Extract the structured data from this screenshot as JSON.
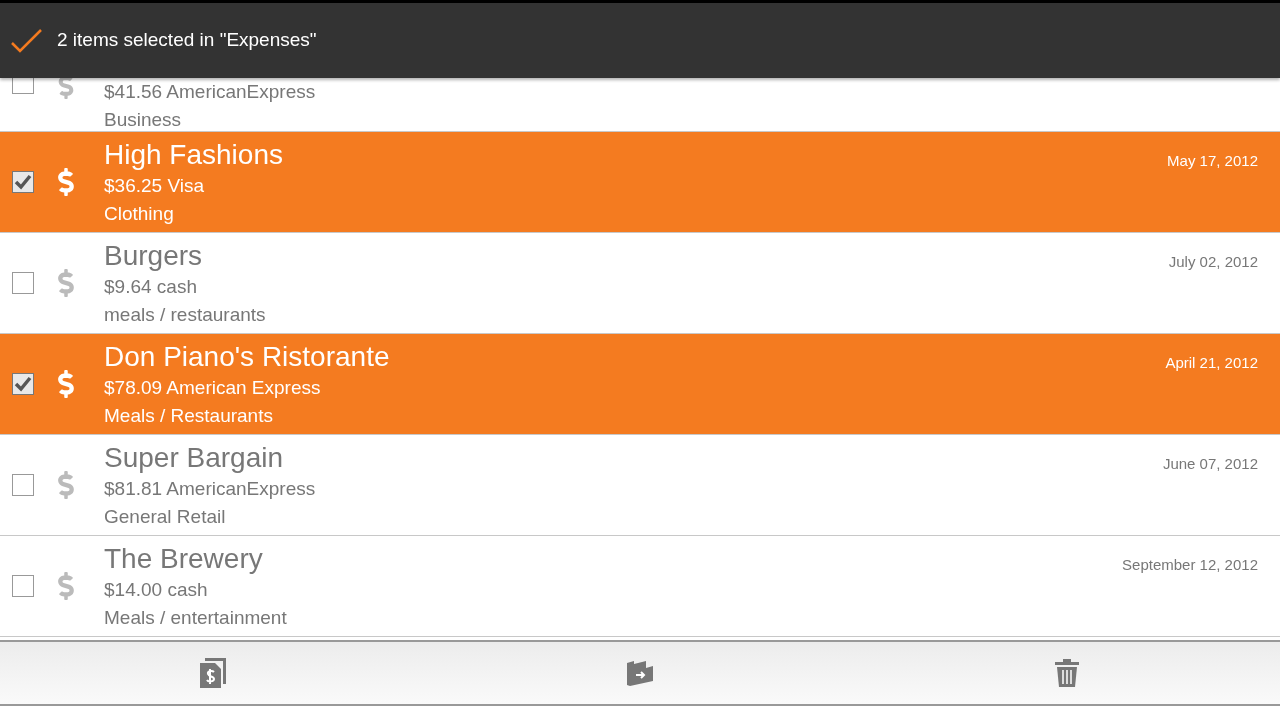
{
  "action_bar": {
    "title": "2 items selected in \"Expenses\""
  },
  "expenses": [
    {
      "kind": "partial",
      "selected": false,
      "amount": "$41.56 AmericanExpress",
      "category": "Business"
    },
    {
      "kind": "full",
      "selected": true,
      "title": "High Fashions",
      "amount": "$36.25 Visa",
      "category": "Clothing",
      "date": "May 17, 2012"
    },
    {
      "kind": "full",
      "selected": false,
      "title": "Burgers",
      "amount": "$9.64 cash",
      "category": "meals / restaurants",
      "date": "July 02, 2012"
    },
    {
      "kind": "full",
      "selected": true,
      "title": "Don Piano's Ristorante",
      "amount": "$78.09 American Express",
      "category": "Meals / Restaurants",
      "date": "April 21, 2012"
    },
    {
      "kind": "full",
      "selected": false,
      "title": "Super Bargain",
      "amount": "$81.81 AmericanExpress",
      "category": "General Retail",
      "date": "June 07, 2012"
    },
    {
      "kind": "full",
      "selected": false,
      "title": "The Brewery",
      "amount": "$14.00 cash",
      "category": "Meals / entertainment",
      "date": "September 12, 2012"
    }
  ]
}
